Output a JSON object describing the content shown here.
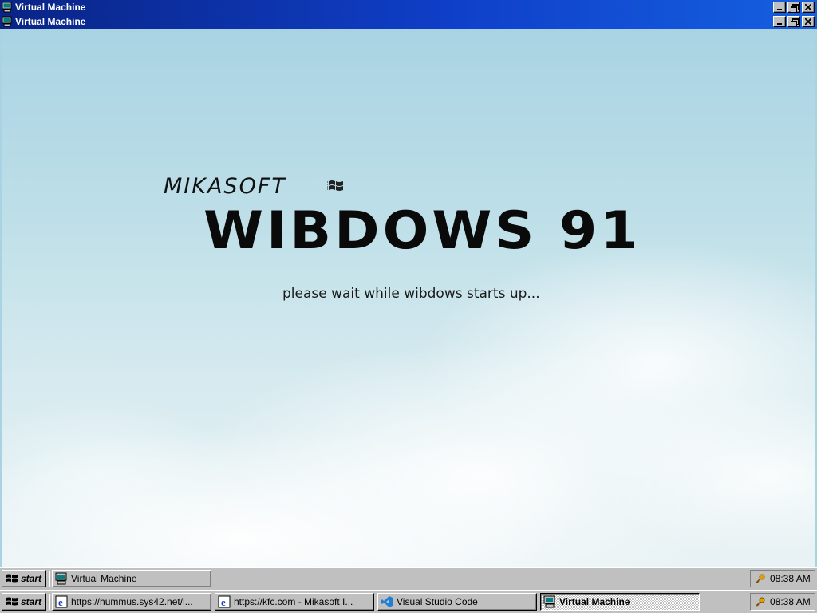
{
  "window": {
    "outer_title": "Virtual Machine",
    "inner_title": "Virtual Machine"
  },
  "boot_screen": {
    "brand": "MIKASOFT",
    "product": "WIBDOWS 91",
    "message": "please wait while wibdows starts up..."
  },
  "taskbar_upper": {
    "start_label": "start",
    "tasks": [
      {
        "label": "Virtual Machine",
        "icon": "computer-icon",
        "active": false
      }
    ],
    "clock": "08:38 AM"
  },
  "taskbar_lower": {
    "start_label": "start",
    "tasks": [
      {
        "label": "https://hummus.sys42.net/i...",
        "icon": "ie-icon",
        "active": false
      },
      {
        "label": "https://kfc.com - Mikasoft I...",
        "icon": "ie-icon",
        "active": false
      },
      {
        "label": "Visual Studio Code",
        "icon": "vscode-icon",
        "active": false
      },
      {
        "label": "Virtual Machine",
        "icon": "computer-icon",
        "active": true
      }
    ],
    "clock": "08:38 AM"
  },
  "colors": {
    "titlebar_start": "#0a2486",
    "titlebar_end": "#1560e0",
    "sky": "#a9d3e3",
    "chrome": "#c0c0c0"
  }
}
